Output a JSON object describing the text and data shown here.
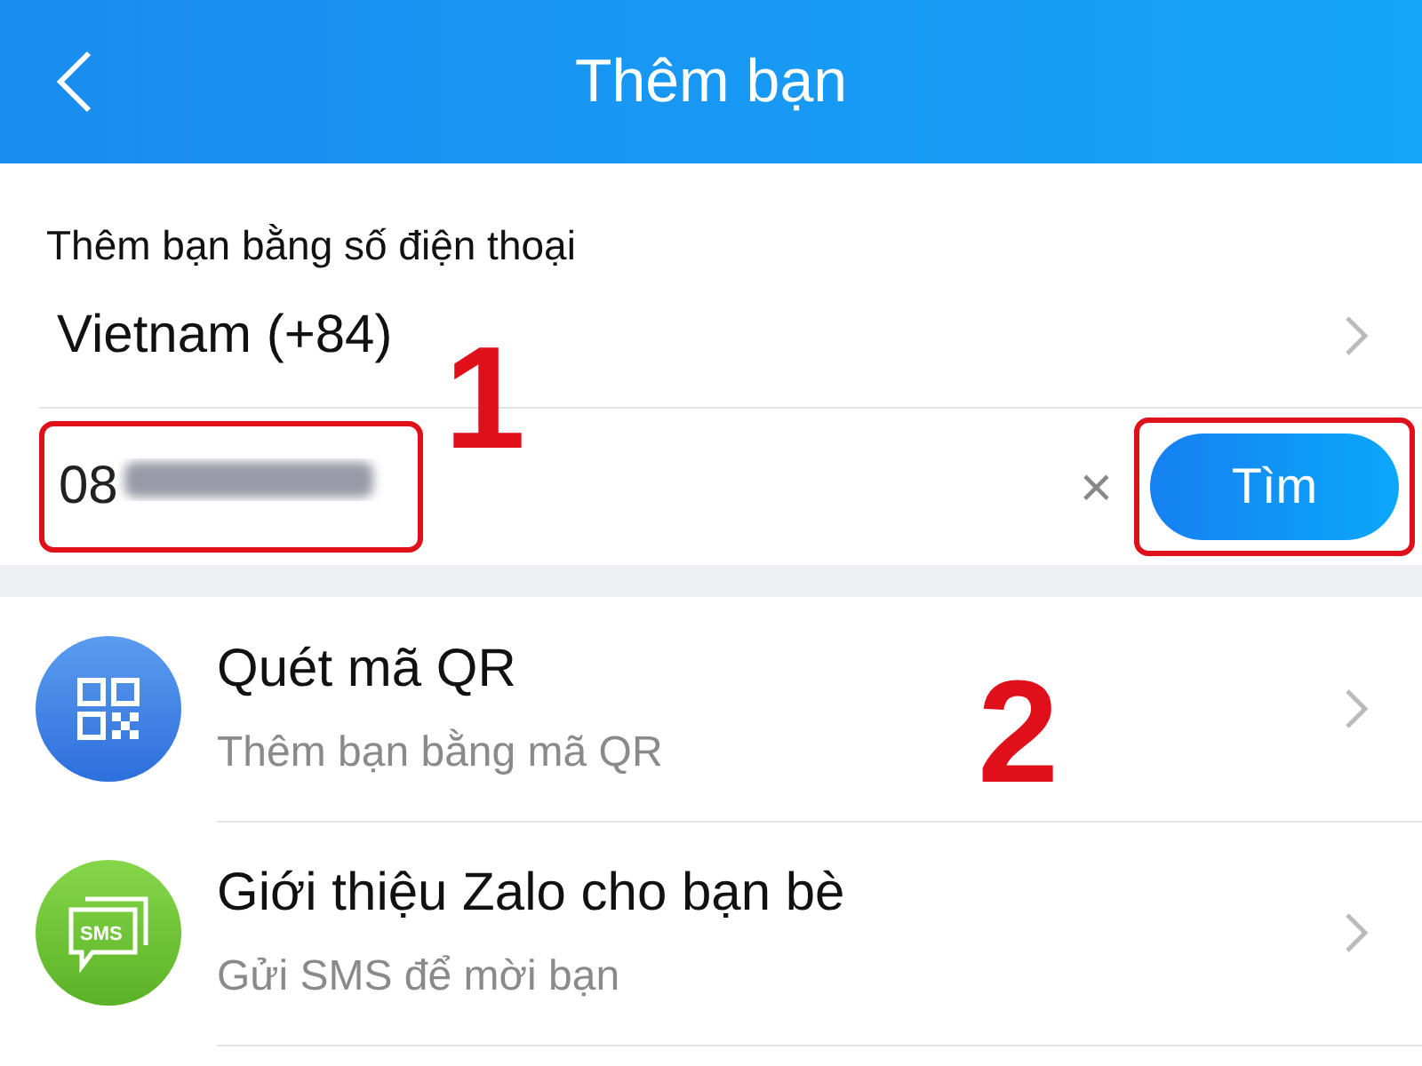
{
  "header": {
    "title": "Thêm bạn"
  },
  "phone_section": {
    "title": "Thêm bạn bằng số điện thoại",
    "country": "Vietnam (+84)",
    "number": "08",
    "number_blurred": true,
    "clear_icon": "×",
    "search_button": "Tìm"
  },
  "options": [
    {
      "kind": "qr",
      "title": "Quét mã QR",
      "subtitle": "Thêm bạn bằng mã QR"
    },
    {
      "kind": "sms",
      "title": "Giới thiệu Zalo cho bạn bè",
      "subtitle": "Gửi SMS để mời bạn",
      "icon_text": "SMS"
    }
  ],
  "annotations": [
    {
      "kind": "step",
      "label": "1"
    },
    {
      "kind": "step",
      "label": "2"
    }
  ]
}
